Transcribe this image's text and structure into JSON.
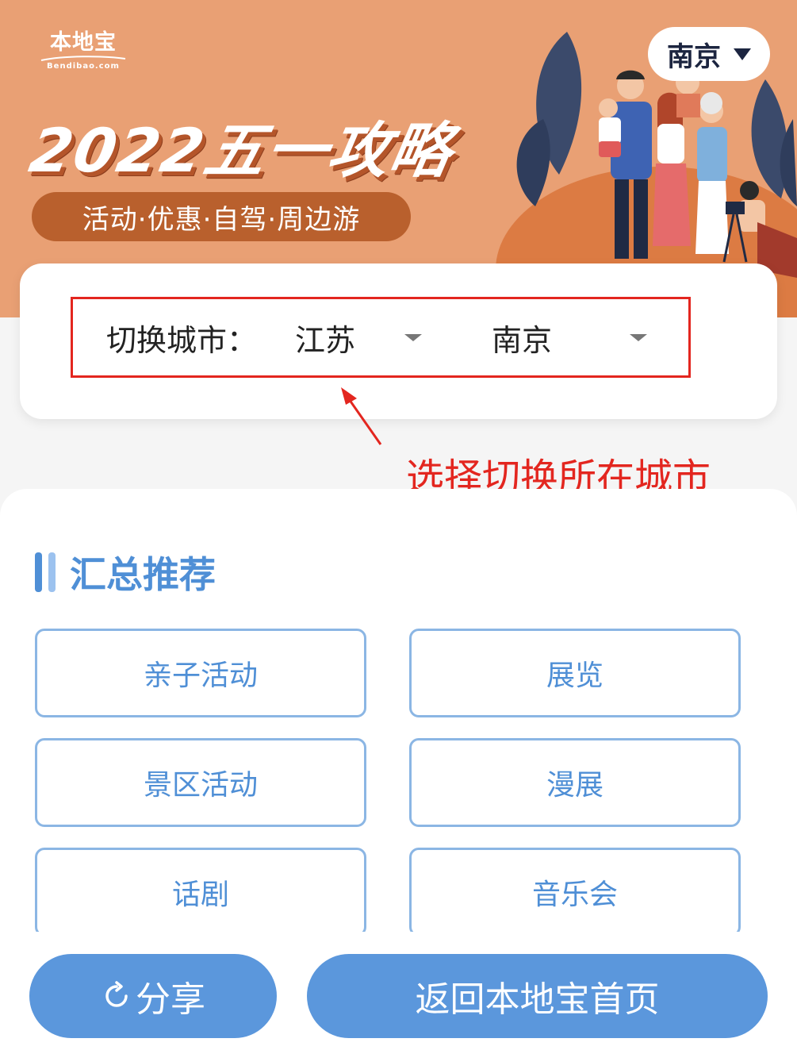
{
  "banner": {
    "logo_text": "本地宝",
    "logo_sub": "Bendibao.com",
    "city_pill": "南京",
    "title": "2022五一攻略",
    "tagline": "活动·优惠·自驾·周边游"
  },
  "city_switch": {
    "label": "切换城市：",
    "province": "江苏",
    "city": "南京"
  },
  "annotation": {
    "text": "选择切换所在城市",
    "color": "#e3261f"
  },
  "recommend": {
    "title": "汇总推荐",
    "items": [
      {
        "label": "亲子活动"
      },
      {
        "label": "展览"
      },
      {
        "label": "景区活动"
      },
      {
        "label": "漫展"
      },
      {
        "label": "话剧"
      },
      {
        "label": "音乐会"
      }
    ]
  },
  "footer": {
    "share_label": "分享",
    "home_label": "返回本地宝首页"
  },
  "colors": {
    "banner_bg": "#e9a074",
    "accent_blue": "#4f8fd6",
    "button_blue": "#5b97dc",
    "highlight_red": "#e3261f"
  },
  "icons": [
    "share-icon",
    "chevron-down-icon",
    "logo-swoosh"
  ]
}
